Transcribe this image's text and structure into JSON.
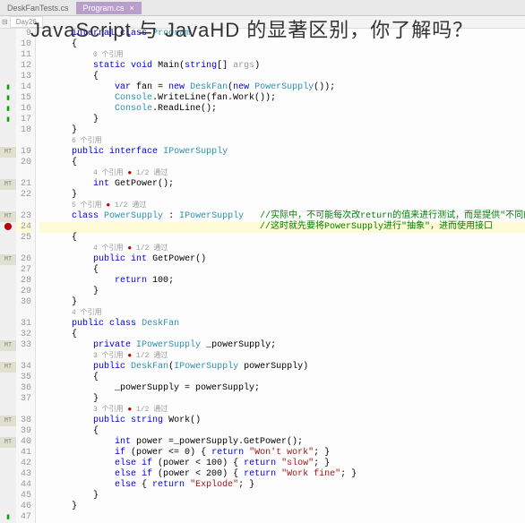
{
  "overlay_title": "JavaScript 与 JavaHD 的显著区别，你了解吗？",
  "tabs": {
    "inactive": "DeskFanTests.cs",
    "active": "Program.cs"
  },
  "sub_tab": "Day26",
  "lines": [
    {
      "n": 9,
      "mark": "",
      "html": "<span class='kw'>internal</span> <span class='kw'>class</span> <span class='type'>Program</span>"
    },
    {
      "n": 10,
      "mark": "",
      "html": "{"
    },
    {
      "n": 11,
      "mark": "",
      "html": "    <span class='hint'>0 个引用</span>"
    },
    {
      "n": 12,
      "mark": "",
      "html": "    <span class='kw'>static</span> <span class='kw'>void</span> Main(<span class='kw'>string</span>[] <span style='color:#999'>args</span>)"
    },
    {
      "n": 13,
      "mark": "",
      "html": "    {"
    },
    {
      "n": 14,
      "mark": "a1",
      "html": "        <span class='kw'>var</span> fan = <span class='kw'>new</span> <span class='type'>DeskFan</span>(<span class='kw'>new</span> <span class='type'>PowerSupply</span>());"
    },
    {
      "n": 15,
      "mark": "a1",
      "html": "        <span class='type'>Console</span>.WriteLine(fan.Work());"
    },
    {
      "n": 16,
      "mark": "a1",
      "html": "        <span class='type'>Console</span>.ReadLine();"
    },
    {
      "n": 17,
      "mark": "a1",
      "html": "    }"
    },
    {
      "n": 18,
      "mark": "",
      "html": "}"
    },
    {
      "n": "",
      "mark": "",
      "html": "<span class='hint'>6 个引用</span>"
    },
    {
      "n": 19,
      "mark": "mt",
      "html": "<span class='kw'>public</span> <span class='kw'>interface</span> <span class='type'>IPowerSupply</span>"
    },
    {
      "n": 20,
      "mark": "",
      "html": "{"
    },
    {
      "n": "",
      "mark": "",
      "html": "    <span class='hint'>4 个引用 <span class='dot'>●</span> 1/2 通过</span>"
    },
    {
      "n": 21,
      "mark": "mt",
      "html": "    <span class='kw'>int</span> GetPower();"
    },
    {
      "n": 22,
      "mark": "",
      "html": "}"
    },
    {
      "n": "",
      "mark": "",
      "html": "<span class='hint'>5 个引用 <span class='dot'>●</span> 1/2 通过</span>"
    },
    {
      "n": 23,
      "mark": "mt",
      "html": "<span class='kw'>class</span> <span class='type'>PowerSupply</span> : <span class='type'>IPowerSupply</span>   <span class='cmt'>//实际中，不可能每次改return的值来进行测试，而是提供\"不同的\"PowerSupply来测试</span>"
    },
    {
      "n": 24,
      "mark": "mod",
      "cursor": true,
      "html": "                                   <span class='cmt'>//这时就先要将PowerSupply进行\"抽象\"，进而使用接口</span>"
    },
    {
      "n": 25,
      "mark": "",
      "html": "{"
    },
    {
      "n": "",
      "mark": "",
      "html": "    <span class='hint'>4 个引用 <span class='dot'>●</span> 1/2 通过</span>"
    },
    {
      "n": 26,
      "mark": "mt",
      "html": "    <span class='kw'>public</span> <span class='kw'>int</span> GetPower()"
    },
    {
      "n": 27,
      "mark": "",
      "html": "    {"
    },
    {
      "n": 28,
      "mark": "",
      "html": "        <span class='kw'>return</span> <span class='num'>100</span>;"
    },
    {
      "n": 29,
      "mark": "",
      "html": "    }"
    },
    {
      "n": 30,
      "mark": "",
      "html": "}"
    },
    {
      "n": "",
      "mark": "",
      "html": "<span class='hint'>4 个引用</span>"
    },
    {
      "n": 31,
      "mark": "",
      "html": "<span class='kw'>public</span> <span class='kw'>class</span> <span class='type'>DeskFan</span>"
    },
    {
      "n": 32,
      "mark": "",
      "html": "{"
    },
    {
      "n": 33,
      "mark": "mt",
      "html": "    <span class='kw'>private</span> <span class='type'>IPowerSupply</span> _powerSupply;"
    },
    {
      "n": "",
      "mark": "",
      "html": "    <span class='hint'>3 个引用 <span class='dot'>●</span> 1/2 通过</span>"
    },
    {
      "n": 34,
      "mark": "mt",
      "html": "    <span class='kw'>public</span> <span class='type'>DeskFan</span>(<span class='type'>IPowerSupply</span> powerSupply)"
    },
    {
      "n": 35,
      "mark": "",
      "html": "    {"
    },
    {
      "n": 36,
      "mark": "",
      "html": "        _powerSupply = powerSupply;"
    },
    {
      "n": 37,
      "mark": "",
      "html": "    }"
    },
    {
      "n": "",
      "mark": "",
      "html": "    <span class='hint'>3 个引用 <span class='dot'>●</span> 1/2 通过</span>"
    },
    {
      "n": 38,
      "mark": "mt",
      "html": "    <span class='kw'>public</span> <span class='kw'>string</span> Work()"
    },
    {
      "n": 39,
      "mark": "",
      "html": "    {"
    },
    {
      "n": 40,
      "mark": "mt",
      "html": "        <span class='kw'>int</span> power =_powerSupply.GetPower();"
    },
    {
      "n": 41,
      "mark": "",
      "html": "        <span class='kw'>if</span> (power <= <span class='num'>0</span>) { <span class='kw'>return</span> <span class='str'>\"Won't work\"</span>; }"
    },
    {
      "n": 42,
      "mark": "",
      "html": "        <span class='kw'>else if</span> (power < <span class='num'>100</span>) { <span class='kw'>return</span> <span class='str'>\"slow\"</span>; }"
    },
    {
      "n": 43,
      "mark": "",
      "html": "        <span class='kw'>else if</span> (power < <span class='num'>200</span>) { <span class='kw'>return</span> <span class='str'>\"Work fine\"</span>; }"
    },
    {
      "n": 44,
      "mark": "",
      "html": "        <span class='kw'>else</span> { <span class='kw'>return</span> <span class='str'>\"Explode\"</span>; }"
    },
    {
      "n": 45,
      "mark": "",
      "html": "    }"
    },
    {
      "n": 46,
      "mark": "",
      "html": "}"
    },
    {
      "n": 47,
      "mark": "a1",
      "html": ""
    }
  ]
}
